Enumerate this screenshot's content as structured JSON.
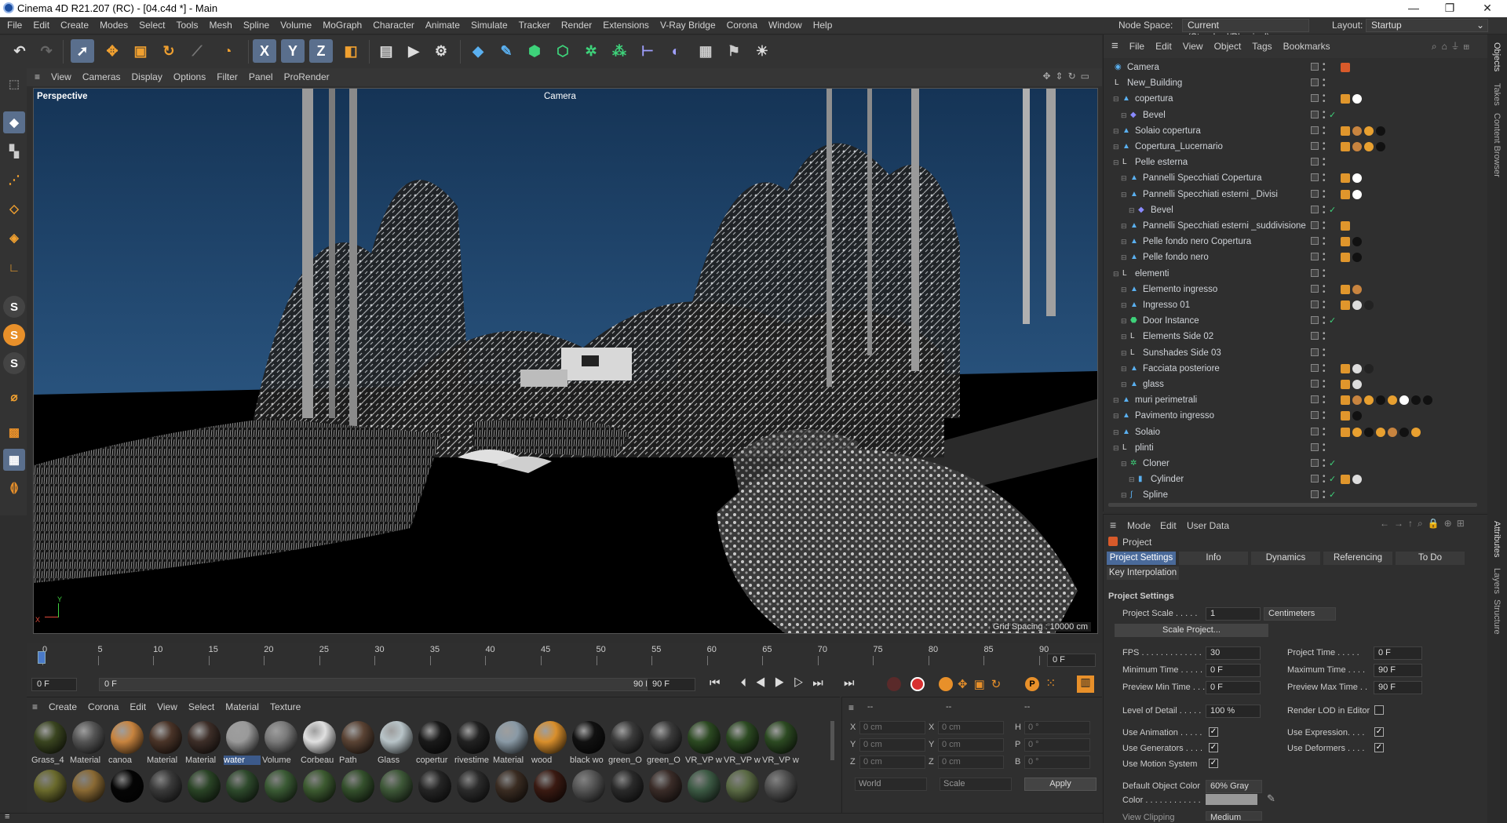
{
  "window": {
    "title": "Cinema 4D R21.207 (RC) - [04.c4d *] - Main",
    "min": "—",
    "max": "❐",
    "close": "✕"
  },
  "menu": [
    "File",
    "Edit",
    "Create",
    "Modes",
    "Select",
    "Tools",
    "Mesh",
    "Spline",
    "Volume",
    "MoGraph",
    "Character",
    "Animate",
    "Simulate",
    "Tracker",
    "Render",
    "Extensions",
    "V-Ray Bridge",
    "Corona",
    "Window",
    "Help"
  ],
  "menu_right": {
    "node_space_label": "Node Space:",
    "node_space_value": "Current (Standard/Physical)",
    "layout_label": "Layout:",
    "layout_value": "Startup"
  },
  "toolbar": {
    "x": "X",
    "y": "Y",
    "z": "Z"
  },
  "viewport": {
    "menu": [
      "View",
      "Cameras",
      "Display",
      "Options",
      "Filter",
      "Panel",
      "ProRender"
    ],
    "name": "Perspective",
    "camera": "Camera",
    "grid": "Grid Spacing : 10000 cm",
    "axis_y": "Y",
    "axis_x": "X"
  },
  "timeline": {
    "ticks": [
      "0",
      "5",
      "10",
      "15",
      "20",
      "25",
      "30",
      "35",
      "40",
      "45",
      "50",
      "55",
      "60",
      "65",
      "70",
      "75",
      "80",
      "85",
      "90"
    ],
    "frame_value": "0 F"
  },
  "playback": {
    "start": "0 F",
    "range_start": "0 F",
    "range_end": "90 F",
    "end": "90 F"
  },
  "materials": {
    "menu": [
      "Create",
      "Corona",
      "Edit",
      "View",
      "Select",
      "Material",
      "Texture"
    ],
    "row1": [
      {
        "label": "Grass_4",
        "color": "#3a4520"
      },
      {
        "label": "Material",
        "color": "#555555"
      },
      {
        "label": "canoa",
        "color": "#c8843f"
      },
      {
        "label": "Material",
        "color": "#4a3428"
      },
      {
        "label": "Material",
        "color": "#3d2e28"
      },
      {
        "label": "water",
        "color": "#9a9a9a"
      },
      {
        "label": "Volume",
        "color": "#7a7a7a"
      },
      {
        "label": "Corbeau",
        "color": "#e0e0e0"
      },
      {
        "label": "Path",
        "color": "#5a4334"
      },
      {
        "label": "Glass",
        "color": "#b8c4c8"
      },
      {
        "label": "copertur",
        "color": "#1a1a1a"
      },
      {
        "label": "rivestime",
        "color": "#222222"
      },
      {
        "label": "Material",
        "color": "#8a9aa6"
      },
      {
        "label": "wood",
        "color": "#d98f2c"
      },
      {
        "label": "black wo",
        "color": "#111111"
      },
      {
        "label": "green_O",
        "color": "#3b3b3b"
      },
      {
        "label": "green_O",
        "color": "#3b3b3b"
      },
      {
        "label": "VR_VP w",
        "color": "#2c4a22"
      },
      {
        "label": "VR_VP w",
        "color": "#2c4a22"
      },
      {
        "label": "VR_VP w",
        "color": "#2c4a22"
      }
    ],
    "row2": [
      "#6a6a2c",
      "#8a6a34",
      "#050505",
      "#3a3a3a",
      "#2a4426",
      "#2e4a2c",
      "#3a5a34",
      "#3c5a30",
      "#34502c",
      "#3e5838",
      "#252525",
      "#2b2b2b",
      "#3a2c22",
      "#3a1a12",
      "#555555",
      "#2a2a2a",
      "#3a2c28",
      "#3c5a44",
      "#5a6a44",
      "#505050"
    ]
  },
  "coords": {
    "header": [
      "--",
      "--",
      "--"
    ],
    "rows": [
      {
        "a": "X",
        "av": "0 cm",
        "b": "X",
        "bv": "0 cm",
        "c": "H",
        "cv": "0 °"
      },
      {
        "a": "Y",
        "av": "0 cm",
        "b": "Y",
        "bv": "0 cm",
        "c": "P",
        "cv": "0 °"
      },
      {
        "a": "Z",
        "av": "0 cm",
        "b": "Z",
        "bv": "0 cm",
        "c": "B",
        "cv": "0 °"
      }
    ],
    "world": "World",
    "scale": "Scale",
    "apply": "Apply"
  },
  "objects": {
    "menu": [
      "File",
      "Edit",
      "View",
      "Object",
      "Tags",
      "Bookmarks"
    ],
    "rows": [
      {
        "name": "Camera",
        "indent": 0,
        "icon": "camera",
        "tags": [
          "#d85a2a"
        ]
      },
      {
        "name": "New_Building",
        "indent": 0,
        "icon": "null",
        "tags": []
      },
      {
        "name": "copertura",
        "indent": 1,
        "icon": "poly",
        "tags": [
          "#e0962c",
          "#ffffff"
        ]
      },
      {
        "name": "Bevel",
        "indent": 2,
        "icon": "deformer",
        "tags": []
      },
      {
        "name": "Solaio copertura",
        "indent": 1,
        "icon": "poly",
        "tags": [
          "#e0962c",
          "#c8843f",
          "#e8a030",
          "#111111"
        ]
      },
      {
        "name": "Copertura_Lucernario",
        "indent": 1,
        "icon": "poly",
        "tags": [
          "#e0962c",
          "#c8843f",
          "#e8a030",
          "#111111"
        ]
      },
      {
        "name": "Pelle esterna",
        "indent": 1,
        "icon": "null",
        "tags": []
      },
      {
        "name": "Pannelli Specchiati Copertura",
        "indent": 2,
        "icon": "poly",
        "tags": [
          "#e0962c",
          "#ffffff"
        ]
      },
      {
        "name": "Pannelli Specchiati esterni _Divisi",
        "indent": 2,
        "icon": "poly",
        "tags": [
          "#e0962c",
          "#ffffff"
        ]
      },
      {
        "name": "Bevel",
        "indent": 3,
        "icon": "deformer",
        "tags": []
      },
      {
        "name": "Pannelli Specchiati esterni _suddivisione",
        "indent": 2,
        "icon": "poly",
        "tags": [
          "#e0962c"
        ]
      },
      {
        "name": "Pelle fondo nero Copertura",
        "indent": 2,
        "icon": "poly",
        "tags": [
          "#e0962c",
          "#111111"
        ]
      },
      {
        "name": "Pelle fondo nero",
        "indent": 2,
        "icon": "poly",
        "tags": [
          "#e0962c",
          "#111111"
        ]
      },
      {
        "name": "elementi",
        "indent": 1,
        "icon": "null",
        "tags": []
      },
      {
        "name": "Elemento ingresso",
        "indent": 2,
        "icon": "poly",
        "tags": [
          "#e0962c",
          "#c8843f"
        ]
      },
      {
        "name": "Ingresso 01",
        "indent": 2,
        "icon": "poly",
        "tags": [
          "#e0962c",
          "#dddddd",
          "#222222"
        ]
      },
      {
        "name": "Door Instance",
        "indent": 2,
        "icon": "instance",
        "tags": []
      },
      {
        "name": "Elements Side 02",
        "indent": 2,
        "icon": "null",
        "tags": []
      },
      {
        "name": "Sunshades  Side 03",
        "indent": 2,
        "icon": "null",
        "tags": []
      },
      {
        "name": "Facciata posteriore",
        "indent": 2,
        "icon": "poly",
        "tags": [
          "#e0962c",
          "#dddddd",
          "#222222"
        ]
      },
      {
        "name": "glass",
        "indent": 2,
        "icon": "poly",
        "tags": [
          "#e0962c",
          "#dddddd"
        ]
      },
      {
        "name": "muri perimetrali",
        "indent": 1,
        "icon": "poly",
        "tags": [
          "#e0962c",
          "#c8843f",
          "#e8a030",
          "#111111",
          "#e8a030",
          "#ffffff",
          "#111111",
          "#111111"
        ]
      },
      {
        "name": "Pavimento ingresso",
        "indent": 1,
        "icon": "poly",
        "tags": [
          "#e0962c",
          "#111111"
        ]
      },
      {
        "name": "Solaio",
        "indent": 1,
        "icon": "poly",
        "tags": [
          "#e0962c",
          "#e8a030",
          "#111111",
          "#e8a030",
          "#c8843f",
          "#111111",
          "#e8a030"
        ]
      },
      {
        "name": "plinti",
        "indent": 1,
        "icon": "null",
        "tags": []
      },
      {
        "name": "Cloner",
        "indent": 2,
        "icon": "cloner",
        "tags": []
      },
      {
        "name": "Cylinder",
        "indent": 3,
        "icon": "cylinder",
        "tags": [
          "#e0962c",
          "#dddddd"
        ]
      },
      {
        "name": "Spline",
        "indent": 2,
        "icon": "spline",
        "tags": []
      }
    ]
  },
  "attributes": {
    "menu": [
      "Mode",
      "Edit",
      "User Data"
    ],
    "title": "Project",
    "tabs": [
      "Project Settings",
      "Info",
      "Dynamics",
      "Referencing",
      "To Do"
    ],
    "tab2": "Key Interpolation",
    "section": "Project Settings",
    "project_scale_label": "Project Scale . . . . .",
    "project_scale_value": "1",
    "unit": "Centimeters",
    "scale_project": "Scale Project...",
    "fps_label": "FPS . . . . . . . . . . . . .",
    "fps": "30",
    "project_time_label": "Project Time  . . . . .",
    "project_time": "0 F",
    "min_time_label": "Minimum Time . . . . .",
    "min_time": "0 F",
    "max_time_label": "Maximum Time . . . .",
    "max_time": "90 F",
    "prev_min_label": "Preview Min Time . . .",
    "prev_min": "0 F",
    "prev_max_label": "Preview Max Time . .",
    "prev_max": "90 F",
    "lod_label": "Level of Detail  . . . . .",
    "lod": "100 %",
    "render_lod_label": "Render LOD in Editor",
    "use_anim": "Use Animation . . . . .",
    "use_expr": "Use Expression. . . .",
    "use_gen": "Use Generators . . . .",
    "use_def": "Use Deformers . . . .",
    "use_motion": "Use Motion System",
    "default_color_label": "Default Object Color",
    "default_color": "60% Gray",
    "color_label": "Color  . . . . . . . . . . . .",
    "view_clipping_label": "View Clipping",
    "view_clipping": "Medium",
    "check": "✓"
  },
  "right_tabs": [
    "Objects",
    "Takes",
    "Content Browser",
    "Attributes",
    "Layers",
    "Structure"
  ],
  "icons": {
    "undo": "undo-icon",
    "redo": "redo-icon",
    "menu": "hamburger-icon"
  }
}
